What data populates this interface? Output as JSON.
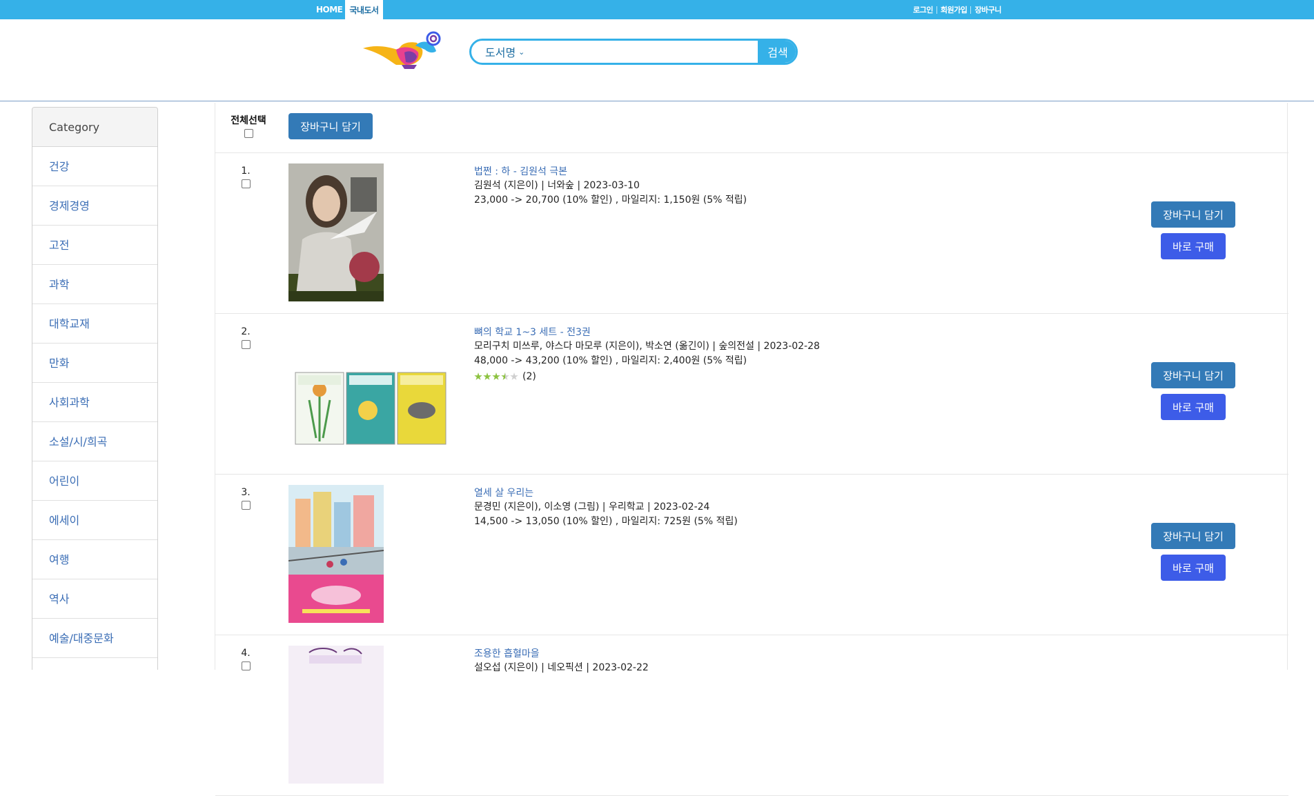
{
  "topnav": {
    "home": "HOME",
    "domestic": "국내도서",
    "login": "로그인",
    "signup": "회원가입",
    "cart": "장바구니"
  },
  "search": {
    "scope": "도서명",
    "placeholder": "",
    "button": "검색"
  },
  "sidebar": {
    "header": "Category",
    "items": [
      "건강",
      "경제경영",
      "고전",
      "과학",
      "대학교재",
      "만화",
      "사회과학",
      "소설/시/희곡",
      "어린이",
      "에세이",
      "여행",
      "역사",
      "예술/대중문화"
    ]
  },
  "list": {
    "select_all": "전체선택",
    "add_cart_all": "장바구니 담기",
    "cart_button": "장바구니 담기",
    "buy_button": "바로 구매",
    "books": [
      {
        "num": "1.",
        "title": "법쩐 : 하 - 김원석 극본",
        "meta": "김원석 (지은이) | 너와숲 | 2023-03-10",
        "price": "23,000 -> 20,700 (10% 할인) , 마일리지: 1,150원 (5% 적립)"
      },
      {
        "num": "2.",
        "title": "뼈의 학교 1~3 세트 - 전3권",
        "meta": "모리구치 미쓰루, 야스다 마모루 (지은이), 박소연 (옮긴이) | 숲의전설 | 2023-02-28",
        "price": "48,000 -> 43,200 (10% 할인) , 마일리지: 2,400원 (5% 적립)",
        "rating_stars": 3.5,
        "rating_count": "(2)"
      },
      {
        "num": "3.",
        "title": "열세 살 우리는",
        "meta": "문경민 (지은이), 이소영 (그림) | 우리학교 | 2023-02-24",
        "price": "14,500 -> 13,050 (10% 할인) , 마일리지: 725원 (5% 적립)"
      },
      {
        "num": "4.",
        "title": "조용한 흡혈마을",
        "meta": "설오섭 (지은이) | 네오픽션 | 2023-02-22"
      }
    ]
  },
  "colors": {
    "topbar": "#35b1e8",
    "cart_button": "#337ab7",
    "buy_button": "#3d5ce8",
    "link": "#3a6db5"
  }
}
